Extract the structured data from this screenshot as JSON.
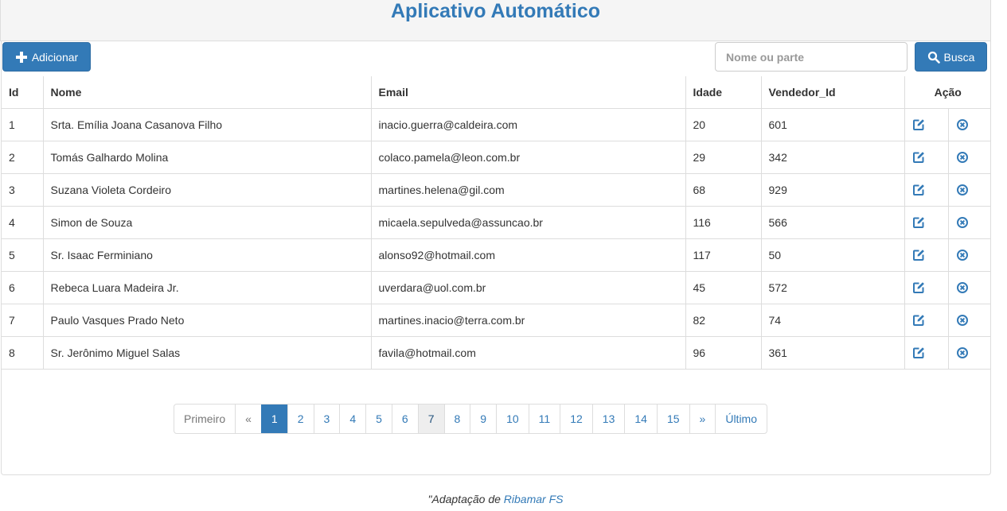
{
  "app": {
    "title": "Aplicativo Automático"
  },
  "toolbar": {
    "add_label": "Adicionar",
    "search_placeholder": "Nome ou parte",
    "search_label": "Busca"
  },
  "table": {
    "headers": [
      "Id",
      "Nome",
      "Email",
      "Idade",
      "Vendedor_Id",
      "Ação"
    ],
    "rows": [
      {
        "id": "1",
        "nome": "Srta. Emília Joana Casanova Filho",
        "email": "inacio.guerra@caldeira.com",
        "idade": "20",
        "vendedor_id": "601"
      },
      {
        "id": "2",
        "nome": "Tomás Galhardo Molina",
        "email": "colaco.pamela@leon.com.br",
        "idade": "29",
        "vendedor_id": "342"
      },
      {
        "id": "3",
        "nome": "Suzana Violeta Cordeiro",
        "email": "martines.helena@gil.com",
        "idade": "68",
        "vendedor_id": "929"
      },
      {
        "id": "4",
        "nome": "Simon de Souza",
        "email": "micaela.sepulveda@assuncao.br",
        "idade": "116",
        "vendedor_id": "566"
      },
      {
        "id": "5",
        "nome": "Sr. Isaac Ferminiano",
        "email": "alonso92@hotmail.com",
        "idade": "117",
        "vendedor_id": "50"
      },
      {
        "id": "6",
        "nome": "Rebeca Luara Madeira Jr.",
        "email": "uverdara@uol.com.br",
        "idade": "45",
        "vendedor_id": "572"
      },
      {
        "id": "7",
        "nome": "Paulo Vasques Prado Neto",
        "email": "martines.inacio@terra.com.br",
        "idade": "82",
        "vendedor_id": "74"
      },
      {
        "id": "8",
        "nome": "Sr. Jerônimo Miguel Salas",
        "email": "favila@hotmail.com",
        "idade": "96",
        "vendedor_id": "361"
      }
    ]
  },
  "pagination": {
    "first_label": "Primeiro",
    "prev_label": "«",
    "pages": [
      "1",
      "2",
      "3",
      "4",
      "5",
      "6",
      "7",
      "8",
      "9",
      "10",
      "11",
      "12",
      "13",
      "14",
      "15"
    ],
    "next_label": "»",
    "last_label": "Último"
  },
  "footer": {
    "prefix": "\"Adaptação de ",
    "link": "Ribamar FS"
  },
  "colors": {
    "primary": "#337ab7",
    "border": "#dddddd",
    "header_bg": "#f5f5f5"
  },
  "icons": {
    "add": "plus-icon",
    "search": "search-icon",
    "edit": "edit-icon",
    "delete": "delete-circle-icon"
  }
}
